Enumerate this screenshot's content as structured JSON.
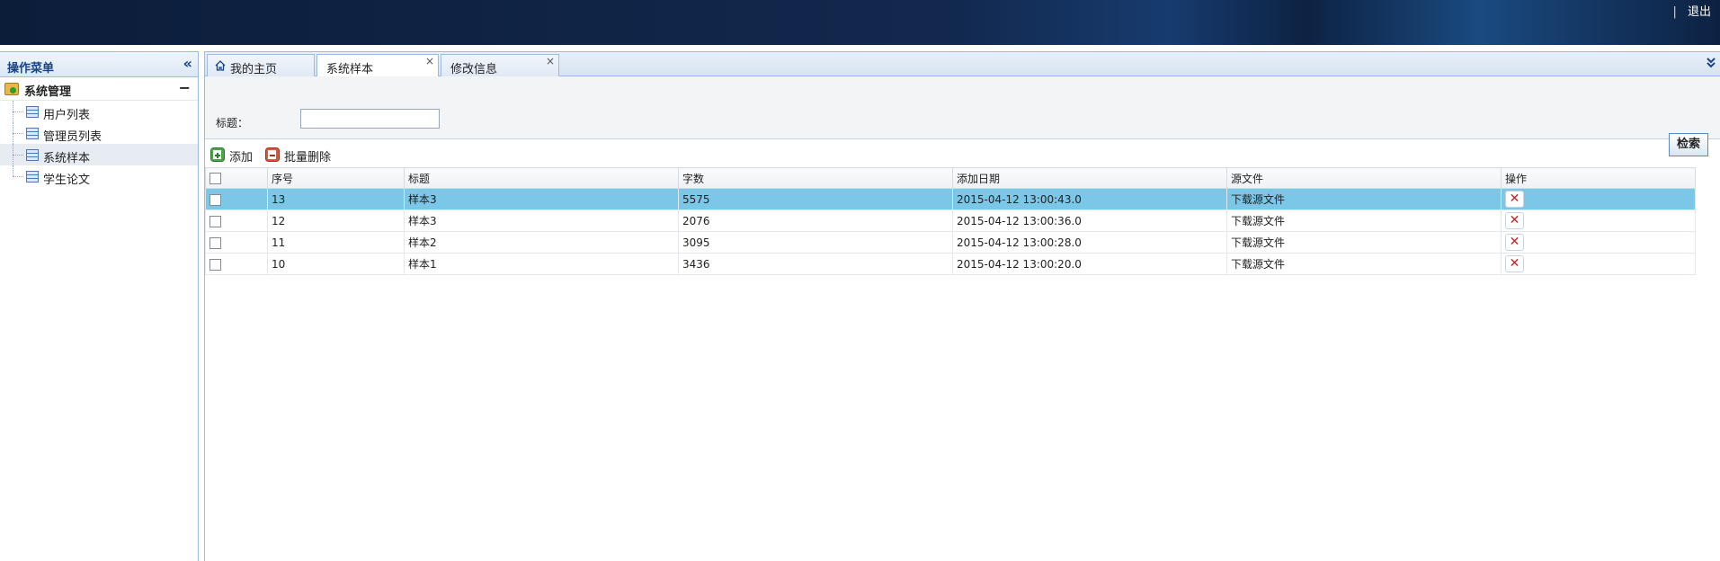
{
  "header": {
    "separator": "|",
    "logout_label": "退出"
  },
  "sidebar": {
    "title": "操作菜单",
    "collapse_icon": "«",
    "root": {
      "label": "系统管理",
      "toggle": "−"
    },
    "items": [
      {
        "label": "用户列表"
      },
      {
        "label": "管理员列表"
      },
      {
        "label": "系统样本"
      },
      {
        "label": "学生论文"
      }
    ]
  },
  "tabs": [
    {
      "label": "我的主页",
      "icon": "home-icon"
    },
    {
      "label": "系统样本",
      "close": "×"
    },
    {
      "label": "修改信息",
      "close": "×"
    }
  ],
  "tab_menu_icon": "chevron-double-down-icon",
  "search": {
    "label": "标题：",
    "value": "",
    "button": "检索"
  },
  "toolbar": {
    "add": "添加",
    "batch_delete": "批量删除"
  },
  "table": {
    "columns": [
      "序号",
      "标题",
      "字数",
      "添加日期",
      "源文件",
      "操作"
    ],
    "rows": [
      {
        "id": "13",
        "title": "样本3",
        "words": "5575",
        "date": "2015-04-12 13:00:43.0",
        "file": "下载源文件",
        "selected": true
      },
      {
        "id": "12",
        "title": "样本3",
        "words": "2076",
        "date": "2015-04-12 13:00:36.0",
        "file": "下载源文件"
      },
      {
        "id": "11",
        "title": "样本2",
        "words": "3095",
        "date": "2015-04-12 13:00:28.0",
        "file": "下载源文件"
      },
      {
        "id": "10",
        "title": "样本1",
        "words": "3436",
        "date": "2015-04-12 13:00:20.0",
        "file": "下载源文件"
      }
    ],
    "delete_icon": "✕"
  },
  "colors": {
    "selected_row": "#7bc7e8",
    "delete_red": "#d21e1e",
    "header_dark": "#0c1d3a"
  }
}
